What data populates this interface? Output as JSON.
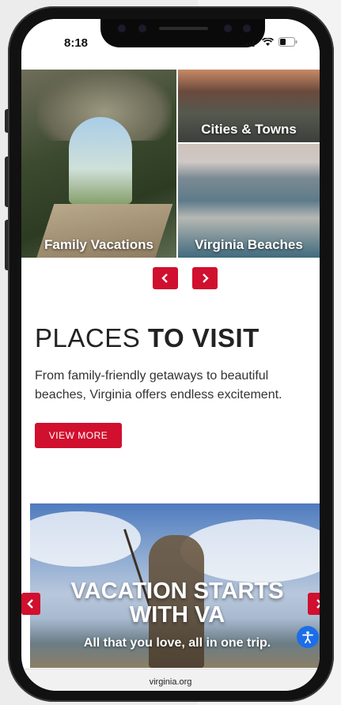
{
  "status_bar": {
    "time": "8:18"
  },
  "tiles": {
    "family": {
      "label": "Family Vacations"
    },
    "cities": {
      "label": "Cities & Towns"
    },
    "beaches": {
      "label": "Virginia Beaches"
    }
  },
  "carousel_nav": {
    "prev_icon": "chevron-left-icon",
    "next_icon": "chevron-right-icon"
  },
  "places": {
    "title_light": "PLACES",
    "title_bold": "TO VISIT",
    "description": "From family-friendly getaways to beautiful beaches, Virginia offers endless excitement.",
    "button_label": "VIEW MORE"
  },
  "hero": {
    "title_line1": "VACATION STARTS",
    "title_line2": "WITH VA",
    "subtitle": "All that you love, all in one trip."
  },
  "browser": {
    "url": "virginia.org"
  },
  "colors": {
    "accent": "#d10f2e",
    "accessibility": "#1c6ee8"
  }
}
